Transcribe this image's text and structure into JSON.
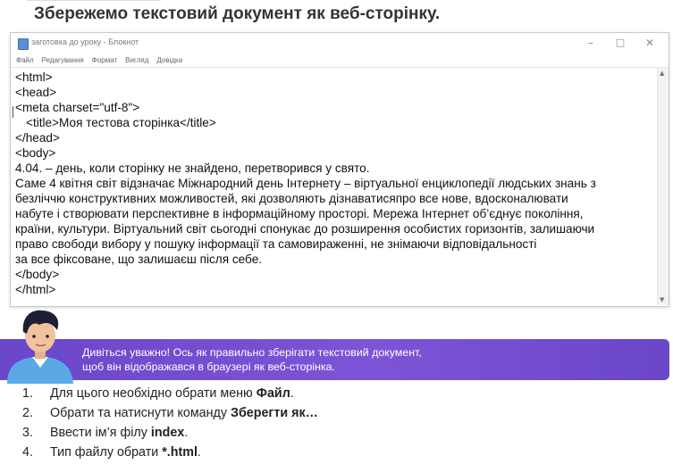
{
  "heading": "Збережемо текстовий документ як веб-сторінку.",
  "window": {
    "title": "заготовка до уроку - Блокнот",
    "controls": {
      "minimize": "–",
      "maximize": "□",
      "close": "✕"
    },
    "menu": [
      "Файл",
      "Редагування",
      "Формат",
      "Вигляд",
      "Довідка"
    ],
    "lines": [
      "<html>",
      "<head>",
      "<meta charset=\"utf-8\">",
      "   <title>Моя тестова сторінка</title>",
      "</head>",
      "<body>",
      "4.04. – день, коли сторінку не знайдено, перетворився у свято.",
      "Саме 4 квітня світ відзначає Міжнародний день Інтернету – віртуальної енциклопедії людських знань з",
      "безліччю конструктивних можливостей, які дозволяють дізнаватисяпро все нове, вдосконалювати",
      "набуте і створювати перспективне в інформаційному просторі. Мережа Інтернет об’єднує покоління,",
      "країни, культури. Віртуальний світ сьогодні спонукає до розширення особистих горизонтів, залишаючи",
      "право свободи вибору у пошуку інформації та самовираженні, не знімаючи відповідальності",
      "за все фіксоване, що залишаєш після себе.",
      "</body>",
      "</html>"
    ]
  },
  "banner": {
    "line1": "Дивіться уважно! Ось як правильно зберігати текстовий документ,",
    "line2": "щоб він відображався в браузері як веб-сторінка."
  },
  "steps": [
    {
      "num": "1.",
      "text": "Для цього необхідно обрати меню ",
      "bold": "Файл",
      "after": "."
    },
    {
      "num": "2.",
      "text": "Обрати та натиснути команду ",
      "bold": "Зберегти як…",
      "after": ""
    },
    {
      "num": "3.",
      "text": "Ввести ім’я філу ",
      "bold": "index",
      "after": "."
    },
    {
      "num": "4.",
      "text": "Тип файлу обрати ",
      "bold": "*.html",
      "after": "."
    }
  ],
  "colors": {
    "banner": "#7150d0",
    "avatar_hair": "#1f1f33",
    "avatar_shirt": "#5aa9e6"
  },
  "icons": [
    "notepad-icon",
    "minimize-icon",
    "maximize-icon",
    "close-icon",
    "avatar"
  ]
}
